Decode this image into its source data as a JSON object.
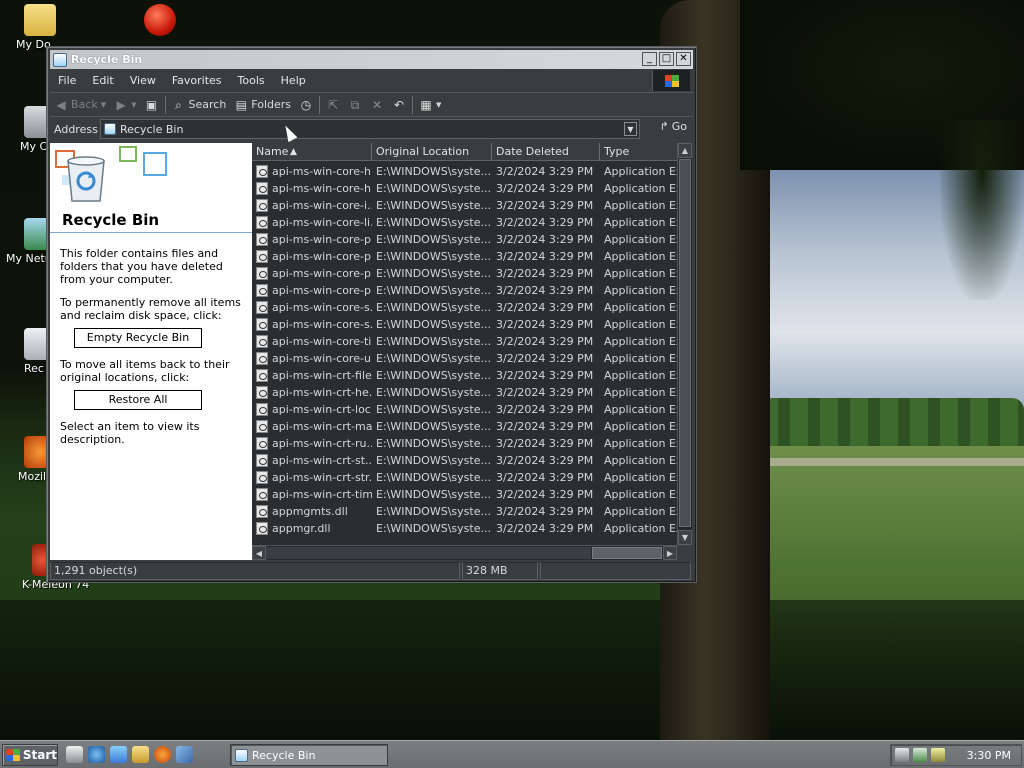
{
  "desktop": {
    "icons": [
      {
        "label": "My Do",
        "name": "my-documents"
      },
      {
        "label": "My C",
        "name": "my-computer"
      },
      {
        "label": "My Netu",
        "name": "my-network"
      },
      {
        "label": "Rec",
        "name": "recycle-bin"
      },
      {
        "label": "Mozill",
        "name": "mozilla"
      },
      {
        "label": "K-Meleon 74",
        "name": "k-meleon"
      }
    ]
  },
  "window": {
    "title": "Recycle Bin",
    "controls": {
      "minimize": "_",
      "maximize": "□",
      "close": "✕"
    },
    "menu": [
      "File",
      "Edit",
      "View",
      "Favorites",
      "Tools",
      "Help"
    ],
    "toolbar": {
      "back": "Back",
      "search": "Search",
      "folders": "Folders"
    },
    "address": {
      "label": "Address",
      "value": "Recycle Bin",
      "go": "Go"
    }
  },
  "taskpane": {
    "title": "Recycle Bin",
    "intro": "This folder contains files and folders that you have deleted from your computer.",
    "empty_text": "To permanently remove all items and reclaim disk space, click:",
    "empty_button": "Empty Recycle Bin",
    "restore_text": "To move all items back to their original locations, click:",
    "restore_button": "Restore All",
    "select_hint": "Select an item to view its description."
  },
  "filelist": {
    "columns": [
      "Name",
      "Original Location",
      "Date Deleted",
      "Type"
    ],
    "rows": [
      [
        "api-ms-win-core-h...",
        "E:\\WINDOWS\\syste...",
        "3/2/2024 3:29 PM",
        "Application Exte"
      ],
      [
        "api-ms-win-core-h...",
        "E:\\WINDOWS\\syste...",
        "3/2/2024 3:29 PM",
        "Application Exte"
      ],
      [
        "api-ms-win-core-i...",
        "E:\\WINDOWS\\syste...",
        "3/2/2024 3:29 PM",
        "Application Exte"
      ],
      [
        "api-ms-win-core-li...",
        "E:\\WINDOWS\\syste...",
        "3/2/2024 3:29 PM",
        "Application Exte"
      ],
      [
        "api-ms-win-core-p...",
        "E:\\WINDOWS\\syste...",
        "3/2/2024 3:29 PM",
        "Application Exte"
      ],
      [
        "api-ms-win-core-p...",
        "E:\\WINDOWS\\syste...",
        "3/2/2024 3:29 PM",
        "Application Exte"
      ],
      [
        "api-ms-win-core-p...",
        "E:\\WINDOWS\\syste...",
        "3/2/2024 3:29 PM",
        "Application Exte"
      ],
      [
        "api-ms-win-core-p...",
        "E:\\WINDOWS\\syste...",
        "3/2/2024 3:29 PM",
        "Application Exte"
      ],
      [
        "api-ms-win-core-s...",
        "E:\\WINDOWS\\syste...",
        "3/2/2024 3:29 PM",
        "Application Exte"
      ],
      [
        "api-ms-win-core-s...",
        "E:\\WINDOWS\\syste...",
        "3/2/2024 3:29 PM",
        "Application Exte"
      ],
      [
        "api-ms-win-core-ti...",
        "E:\\WINDOWS\\syste...",
        "3/2/2024 3:29 PM",
        "Application Exte"
      ],
      [
        "api-ms-win-core-u...",
        "E:\\WINDOWS\\syste...",
        "3/2/2024 3:29 PM",
        "Application Exte"
      ],
      [
        "api-ms-win-crt-file...",
        "E:\\WINDOWS\\syste...",
        "3/2/2024 3:29 PM",
        "Application Exte"
      ],
      [
        "api-ms-win-crt-he...",
        "E:\\WINDOWS\\syste...",
        "3/2/2024 3:29 PM",
        "Application Exte"
      ],
      [
        "api-ms-win-crt-loc...",
        "E:\\WINDOWS\\syste...",
        "3/2/2024 3:29 PM",
        "Application Exte"
      ],
      [
        "api-ms-win-crt-ma...",
        "E:\\WINDOWS\\syste...",
        "3/2/2024 3:29 PM",
        "Application Exte"
      ],
      [
        "api-ms-win-crt-ru...",
        "E:\\WINDOWS\\syste...",
        "3/2/2024 3:29 PM",
        "Application Exte"
      ],
      [
        "api-ms-win-crt-st...",
        "E:\\WINDOWS\\syste...",
        "3/2/2024 3:29 PM",
        "Application Exte"
      ],
      [
        "api-ms-win-crt-str...",
        "E:\\WINDOWS\\syste...",
        "3/2/2024 3:29 PM",
        "Application Exte"
      ],
      [
        "api-ms-win-crt-tim...",
        "E:\\WINDOWS\\syste...",
        "3/2/2024 3:29 PM",
        "Application Exte"
      ],
      [
        "appmgmts.dll",
        "E:\\WINDOWS\\syste...",
        "3/2/2024 3:29 PM",
        "Application Exte"
      ],
      [
        "appmgr.dll",
        "E:\\WINDOWS\\syste...",
        "3/2/2024 3:29 PM",
        "Application Exte"
      ]
    ]
  },
  "status": {
    "objects": "1,291 object(s)",
    "size": "328 MB"
  },
  "taskbar": {
    "start": "Start",
    "task": "Recycle Bin",
    "clock": "3:30 PM"
  },
  "colors": {
    "window_bg": "#3a3d3f",
    "list_bg": "#2b2e30",
    "taskpane_bg": "#ffffff",
    "taskbar_bg": "#6a6e71"
  }
}
